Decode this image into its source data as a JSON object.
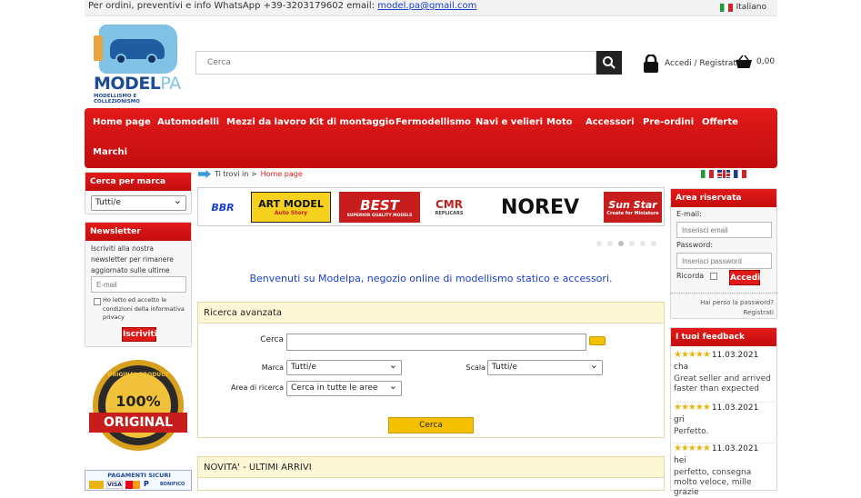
{
  "topbar": {
    "info": "Per ordini, preventivi e info   WhatsApp +39-3203179602   email:",
    "email": "model.pa@gmail.com",
    "language": "Italiano"
  },
  "logo": {
    "brand_a": "MODEL",
    "brand_b": "PA",
    "tagline": "MODELLISMO E COLLEZIONISMO"
  },
  "search": {
    "placeholder": "Cerca"
  },
  "account": {
    "label": "Accedi / Registrati"
  },
  "cart": {
    "total": "0,00"
  },
  "nav": {
    "items": [
      "Home page",
      "Automodelli",
      "Mezzi da lavoro",
      "Kit di montaggio",
      "Fermodellismo",
      "Navi e velieri",
      "Moto",
      "Accessori",
      "Pre-ordini",
      "Offerte",
      "Marchi"
    ]
  },
  "brand_filter": {
    "title": "Cerca per marca",
    "selected": "Tutti/e"
  },
  "newsletter": {
    "title": "Newsletter",
    "text": "Iscriviti alla nostra newsletter per rimanere aggiornato sulle ultime novità e offerte",
    "email_placeholder": "E-mail",
    "privacy": "Ho letto ed accetto le condizioni della informativa privacy",
    "button": "Iscriviti"
  },
  "badge": {
    "top": "ORIGINAL PRODUCT",
    "pct": "100%",
    "label": "ORIGINAL"
  },
  "payments": {
    "title": "PAGAMENTI SICURI",
    "visa": "VISA",
    "paypal": "P",
    "bank": "BONIFICO"
  },
  "breadcrumb": {
    "prefix": "Ti trovi in >",
    "current": "Home page"
  },
  "brands": [
    "BBR",
    "ART MODEL",
    "BEST",
    "CMR",
    "NOREV",
    "Sun Star"
  ],
  "brand_sub": {
    "artmodel": "Auto Story",
    "best": "SUPERIOR QUALITY MODELS",
    "cmr": "REPLICARS",
    "sunstar": "Create for Miniature"
  },
  "welcome": "Benvenuti su Modelpa,  negozio online di modellismo statico e accessori.",
  "advanced_search": {
    "title": "Ricerca avanzata",
    "search_label": "Cerca",
    "brand_label": "Marca",
    "brand_value": "Tutti/e",
    "scale_label": "Scala",
    "scale_value": "Tutti/e",
    "area_label": "Area di ricerca",
    "area_value": "Cerca in tutte le aree",
    "button": "Cerca"
  },
  "news": {
    "title": "NOVITA' - ULTIMI ARRIVI"
  },
  "reserved": {
    "title": "Area riservata",
    "email_label": "E-mail:",
    "email_placeholder": "Inserisci email",
    "password_label": "Password:",
    "password_placeholder": "Inserisci password",
    "remember": "Ricorda",
    "login_button": "Accedi",
    "forgot": "Hai perso la password?",
    "register": "Registrati"
  },
  "feedback": {
    "title": "I tuoi feedback",
    "items": [
      {
        "stars": "★★★★★",
        "date": "11.03.2021",
        "name": "cha",
        "text": "Great seller and arrived faster than expected"
      },
      {
        "stars": "★★★★★",
        "date": "11.03.2021",
        "name": "gri",
        "text": "Perfetto."
      },
      {
        "stars": "★★★★★",
        "date": "11.03.2021",
        "name": "hei",
        "text": "perfetto, consegna molto veloce, mille grazie"
      }
    ]
  },
  "colors": {
    "accent_red": "#e01919",
    "link_blue": "#1a3fcf",
    "box_yellow": "#fdf7d6"
  }
}
